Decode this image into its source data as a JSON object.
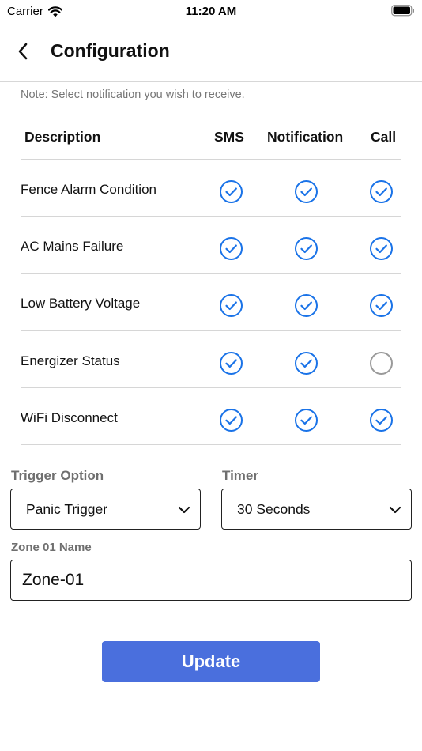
{
  "status_bar": {
    "carrier": "Carrier",
    "time": "11:20 AM"
  },
  "header": {
    "title": "Configuration"
  },
  "note": "Note: Select notification you wish to receive.",
  "table": {
    "columns": {
      "description": "Description",
      "sms": "SMS",
      "notification": "Notification",
      "call": "Call"
    },
    "rows": [
      {
        "label": "Fence Alarm Condition",
        "sms": true,
        "notification": true,
        "call": true
      },
      {
        "label": "AC Mains Failure",
        "sms": true,
        "notification": true,
        "call": true
      },
      {
        "label": "Low Battery Voltage",
        "sms": true,
        "notification": true,
        "call": true
      },
      {
        "label": "Energizer Status",
        "sms": true,
        "notification": true,
        "call": false
      },
      {
        "label": "WiFi Disconnect",
        "sms": true,
        "notification": true,
        "call": true
      }
    ]
  },
  "trigger_option": {
    "label": "Trigger Option",
    "value": "Panic Trigger"
  },
  "timer": {
    "label": "Timer",
    "value": "30 Seconds"
  },
  "zone_name": {
    "label": "Zone 01 Name",
    "value": "Zone-01"
  },
  "update_button": "Update",
  "colors": {
    "accent": "#1a73e8",
    "unchecked": "#9a9a9a",
    "button": "#4a6fdd"
  }
}
